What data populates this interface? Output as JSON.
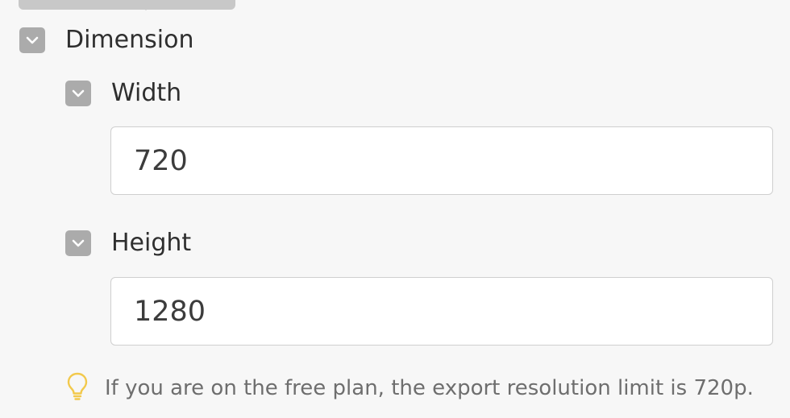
{
  "dimension": {
    "label": "Dimension",
    "toggle_icon": "chevron-down-icon"
  },
  "width": {
    "label": "Width",
    "value": "720",
    "toggle_icon": "chevron-down-icon"
  },
  "height": {
    "label": "Height",
    "value": "1280",
    "toggle_icon": "chevron-down-icon"
  },
  "hint": {
    "icon": "lightbulb-icon",
    "icon_color": "#f2c94c",
    "text": "If you are on the free plan, the export resolution limit is 720p."
  },
  "colors": {
    "background": "#f7f7f7",
    "toggle": "#ababab",
    "tooltip": "#c8c8c8"
  }
}
